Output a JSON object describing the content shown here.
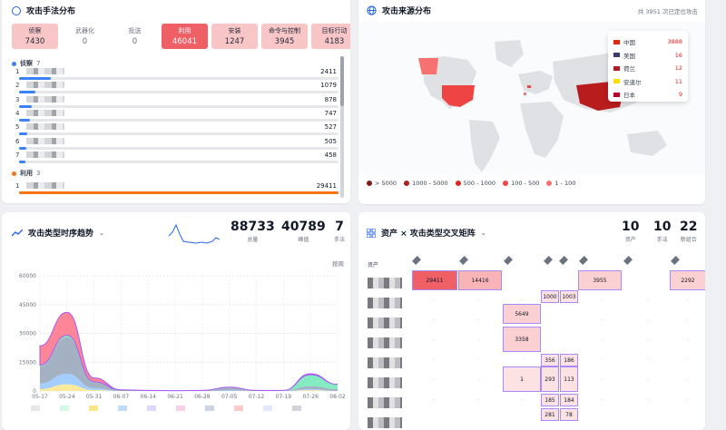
{
  "tactics_card": {
    "title": "攻击手法分布",
    "tactics": [
      {
        "name": "侦察",
        "value": "7430",
        "style": "t-pink"
      },
      {
        "name": "武器化",
        "value": "0",
        "style": "t-light"
      },
      {
        "name": "投送",
        "value": "0",
        "style": "t-light"
      },
      {
        "name": "利用",
        "value": "46041",
        "style": "t-red"
      },
      {
        "name": "安装",
        "value": "1247",
        "style": "t-pink"
      },
      {
        "name": "命令与控制",
        "value": "3945",
        "style": "t-pink"
      },
      {
        "name": "目标行动",
        "value": "4183",
        "style": "t-pink"
      }
    ],
    "recon_header": {
      "label": "侦察",
      "count": "7"
    },
    "recon_rows": [
      {
        "idx": "1",
        "value": "2411",
        "fill": 0.1
      },
      {
        "idx": "2",
        "value": "1079",
        "fill": 0.05
      },
      {
        "idx": "3",
        "value": "878",
        "fill": 0.04
      },
      {
        "idx": "4",
        "value": "747",
        "fill": 0.035
      },
      {
        "idx": "5",
        "value": "527",
        "fill": 0.025
      },
      {
        "idx": "6",
        "value": "505",
        "fill": 0.022
      },
      {
        "idx": "7",
        "value": "458",
        "fill": 0.02
      }
    ],
    "exploit_header": {
      "label": "利用",
      "count": "3"
    },
    "exploit_rows": [
      {
        "idx": "1",
        "value": "29411",
        "fill": 1.0
      }
    ]
  },
  "map_card": {
    "title": "攻击来源分布",
    "summary": "共 3951 次已定位攻击",
    "countries": [
      {
        "name": "中国",
        "count": "3888",
        "flag_color": "#de2910"
      },
      {
        "name": "美国",
        "count": "16",
        "flag_color": "#3c3b6e"
      },
      {
        "name": "荷兰",
        "count": "12",
        "flag_color": "#ae1c28"
      },
      {
        "name": "安道尔",
        "count": "11",
        "flag_color": "#fedf00"
      },
      {
        "name": "日本",
        "count": "9",
        "flag_color": "#bc002d"
      }
    ],
    "legend": [
      {
        "label": "> 5000",
        "color": "#7f1d1d"
      },
      {
        "label": "1000 - 5000",
        "color": "#b91c1c"
      },
      {
        "label": "500 - 1000",
        "color": "#dc2626"
      },
      {
        "label": "100 - 500",
        "color": "#ef4444"
      },
      {
        "label": "1 - 100",
        "color": "#f87171"
      }
    ]
  },
  "timeline_card": {
    "title": "攻击类型时序趋势",
    "stats": [
      {
        "value": "88733",
        "label": "总量"
      },
      {
        "value": "40789",
        "label": "峰值"
      },
      {
        "value": "7",
        "label": "手法"
      }
    ],
    "granularity": "按周",
    "chart_data": {
      "type": "area",
      "x": [
        "05-17",
        "05-24",
        "05-31",
        "06-07",
        "06-14",
        "06-21",
        "06-28",
        "07-05",
        "07-12",
        "07-19",
        "07-26",
        "08-02"
      ],
      "ylim": [
        0,
        60000
      ],
      "yticks": [
        "60000",
        "45000",
        "30000",
        "15000",
        "0"
      ],
      "series": [
        {
          "color": "#fde68a",
          "values": [
            1000,
            3500,
            500,
            0,
            0,
            0,
            0,
            0,
            0,
            0,
            500,
            0
          ]
        },
        {
          "color": "#93c5fd",
          "values": [
            3000,
            5500,
            1000,
            0,
            0,
            0,
            0,
            300,
            0,
            0,
            500,
            0
          ]
        },
        {
          "color": "#94a3b8",
          "values": [
            9000,
            19000,
            3000,
            600,
            300,
            200,
            300,
            1500,
            300,
            200,
            1500,
            1000
          ]
        },
        {
          "color": "#6ee7b7",
          "values": [
            500,
            1000,
            300,
            0,
            0,
            0,
            0,
            200,
            0,
            100,
            6000,
            2500
          ]
        },
        {
          "color": "#fb7185",
          "values": [
            10000,
            12000,
            2000,
            0,
            0,
            0,
            0,
            0,
            0,
            0,
            500,
            0
          ]
        }
      ]
    }
  },
  "matrix_card": {
    "title": "资产 × 攻击类型交叉矩阵",
    "stats": [
      {
        "value": "10",
        "label": "资产"
      },
      {
        "value": "10",
        "label": "手法"
      },
      {
        "value": "22",
        "label": "新组合"
      }
    ],
    "row_header": "资产",
    "values": [
      "29411",
      "14416",
      "3955",
      "2292",
      "1000",
      "1003",
      "5649",
      "3358",
      "356",
      "186",
      "1",
      "293",
      "113",
      "185",
      "184",
      "281",
      "78"
    ]
  }
}
